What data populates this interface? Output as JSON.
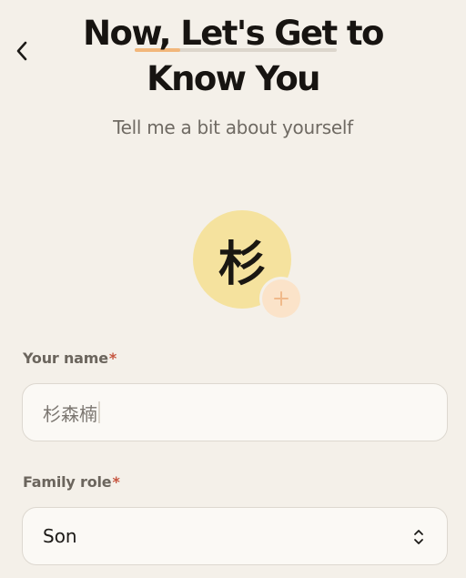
{
  "header": {
    "title_line1": "Now, Let's Get to",
    "title_line2": "Know You",
    "subtitle": "Tell me a bit about yourself",
    "back_icon": "chevron-left-icon"
  },
  "avatar": {
    "initial": "杉",
    "add_icon": "plus-icon",
    "color": "#f5e29e"
  },
  "form": {
    "name": {
      "label": "Your name",
      "required_mark": "*",
      "value": "杉森楠"
    },
    "role": {
      "label": "Family role",
      "required_mark": "*",
      "value": "Son",
      "icon": "chevron-updown-icon"
    }
  },
  "colors": {
    "background": "#f4f0e9",
    "accent": "#f2b77b",
    "required": "#c6553f"
  }
}
